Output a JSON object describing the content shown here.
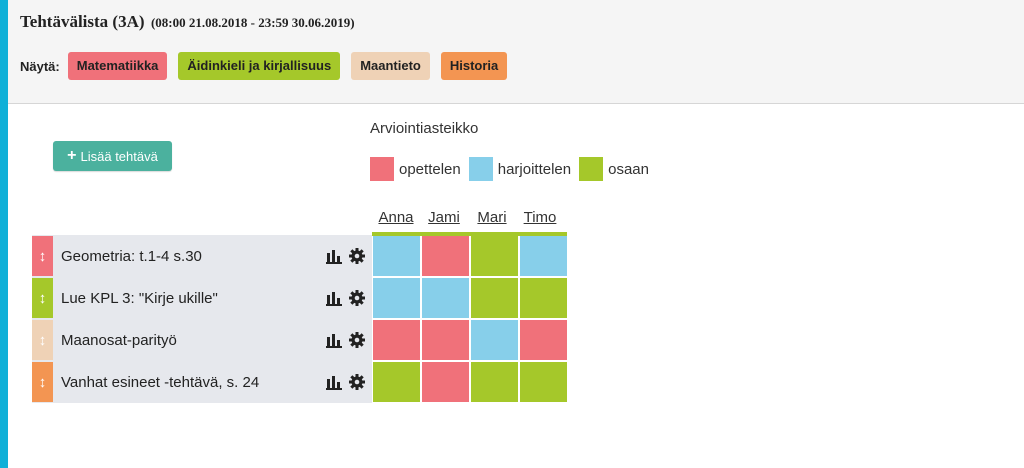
{
  "header": {
    "title": "Tehtävälista (3A)",
    "dates": "(08:00 21.08.2018 - 23:59 30.06.2019)",
    "filter_label": "Näytä:",
    "filters": [
      {
        "label": "Matematiikka",
        "color": "#f0717a"
      },
      {
        "label": "Äidinkieli ja kirjallisuus",
        "color": "#a5c82a"
      },
      {
        "label": "Maantieto",
        "color": "#efd2b6"
      },
      {
        "label": "Historia",
        "color": "#f39552"
      }
    ]
  },
  "add_button": {
    "label": "Lisää tehtävä"
  },
  "scale": {
    "title": "Arviointiasteikko",
    "levels": [
      {
        "label": "opettelen",
        "color": "#f0717a"
      },
      {
        "label": "harjoittelen",
        "color": "#87cfea"
      },
      {
        "label": "osaan",
        "color": "#a5c82a"
      }
    ]
  },
  "students": [
    "Anna",
    "Jami",
    "Mari",
    "Timo"
  ],
  "tasks": [
    {
      "label": "Geometria: t.1-4 s.30",
      "subject_color": "#f0717a",
      "grades": [
        "harjoittelen",
        "opettelen",
        "osaan",
        "harjoittelen"
      ]
    },
    {
      "label": "Lue KPL 3: \"Kirje ukille\"",
      "subject_color": "#a5c82a",
      "grades": [
        "harjoittelen",
        "harjoittelen",
        "osaan",
        "osaan"
      ]
    },
    {
      "label": "Maanosat-parityö",
      "subject_color": "#efd2b6",
      "grades": [
        "opettelen",
        "opettelen",
        "harjoittelen",
        "opettelen"
      ]
    },
    {
      "label": "Vanhat esineet -tehtävä, s. 24",
      "subject_color": "#f39552",
      "grades": [
        "osaan",
        "opettelen",
        "osaan",
        "osaan"
      ]
    }
  ]
}
